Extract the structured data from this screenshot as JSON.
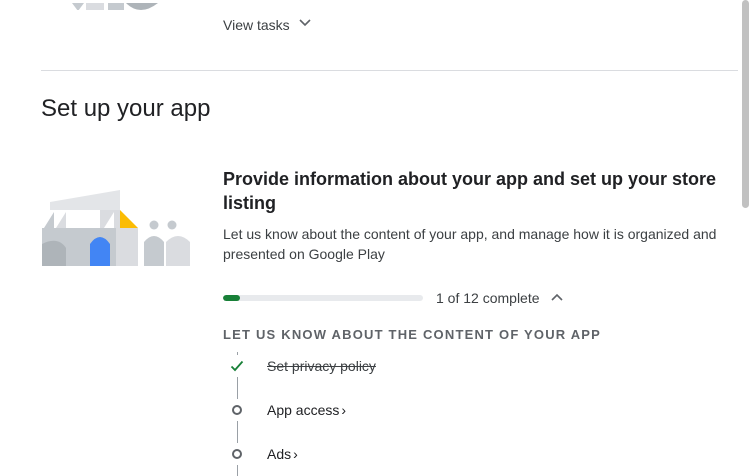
{
  "previous_section": {
    "view_tasks_label": "View tasks"
  },
  "section": {
    "title": "Set up your app"
  },
  "card": {
    "title": "Provide information about your app and set up your store listing",
    "description": "Let us know about the content of your app, and manage how it is organized and presented on Google Play",
    "progress": {
      "completed": 1,
      "total": 12,
      "fraction": 0.0833,
      "label": "1 of 12 complete"
    }
  },
  "task_group": {
    "heading": "LET US KNOW ABOUT THE CONTENT OF YOUR APP",
    "tasks": [
      {
        "label": "Set privacy policy",
        "status": "complete"
      },
      {
        "label": "App access",
        "status": "incomplete",
        "chevron": "›"
      },
      {
        "label": "Ads",
        "status": "incomplete",
        "chevron": "›"
      }
    ]
  },
  "icons": {
    "view_tasks": "chevron-down-icon",
    "progress_toggle": "chevron-up-icon",
    "task_done": "checkmark-icon",
    "task_pending": "circle-icon"
  },
  "colors": {
    "progress": "#188038",
    "check": "#188038",
    "illustration_blue": "#4285f4",
    "illustration_yellow": "#fbbc04",
    "illustration_gray": "#c5cacf"
  }
}
